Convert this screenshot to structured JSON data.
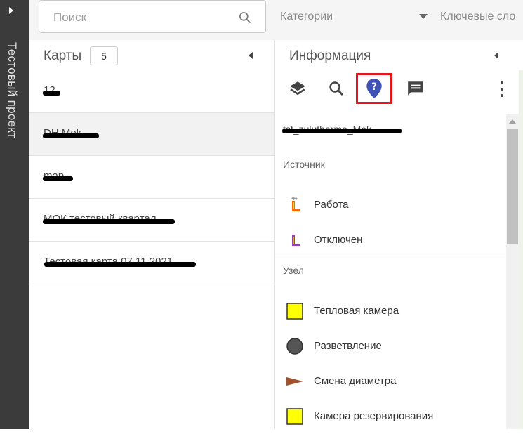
{
  "sidebar": {
    "project_title": "Тестовый проект"
  },
  "topbar": {
    "search_placeholder": "Поиск",
    "categories_label": "Категории",
    "keywords_label": "Ключевые сло"
  },
  "maps": {
    "header": "Карты",
    "count": "5",
    "items": [
      {
        "name": "12",
        "redacted": true
      },
      {
        "name": "DH Mok",
        "redacted": true,
        "active": true
      },
      {
        "name": "map",
        "redacted": true
      },
      {
        "name": "МОК тестовый квартал",
        "redacted": true
      },
      {
        "name": "Тестовая карта 07.11.2021",
        "redacted": true
      }
    ]
  },
  "info": {
    "header": "Информация",
    "tools": [
      "layers-icon",
      "search-icon",
      "info-marker-icon",
      "comment-icon",
      "more-vert-icon"
    ],
    "subtitle": "tst_zuluthermo_Mok",
    "sections": [
      {
        "label": "Источник",
        "items": [
          {
            "label": "Работа",
            "icon": "boiler-working-icon"
          },
          {
            "label": "Отключен",
            "icon": "boiler-off-icon"
          }
        ]
      },
      {
        "label": "Узел",
        "items": [
          {
            "label": "Тепловая камера",
            "icon": "yellow-square-icon"
          },
          {
            "label": "Разветвление",
            "icon": "gray-circle-icon"
          },
          {
            "label": "Смена диаметра",
            "icon": "brown-triangle-icon"
          },
          {
            "label": "Камера резервирования",
            "icon": "yellow-square-icon"
          }
        ]
      }
    ]
  },
  "colors": {
    "selected_outline": "#e8141c",
    "info_marker": "#3f51b5",
    "node_yellow": "#ffff00",
    "branch_gray": "#555555",
    "diameter_brown": "#a0522d"
  }
}
